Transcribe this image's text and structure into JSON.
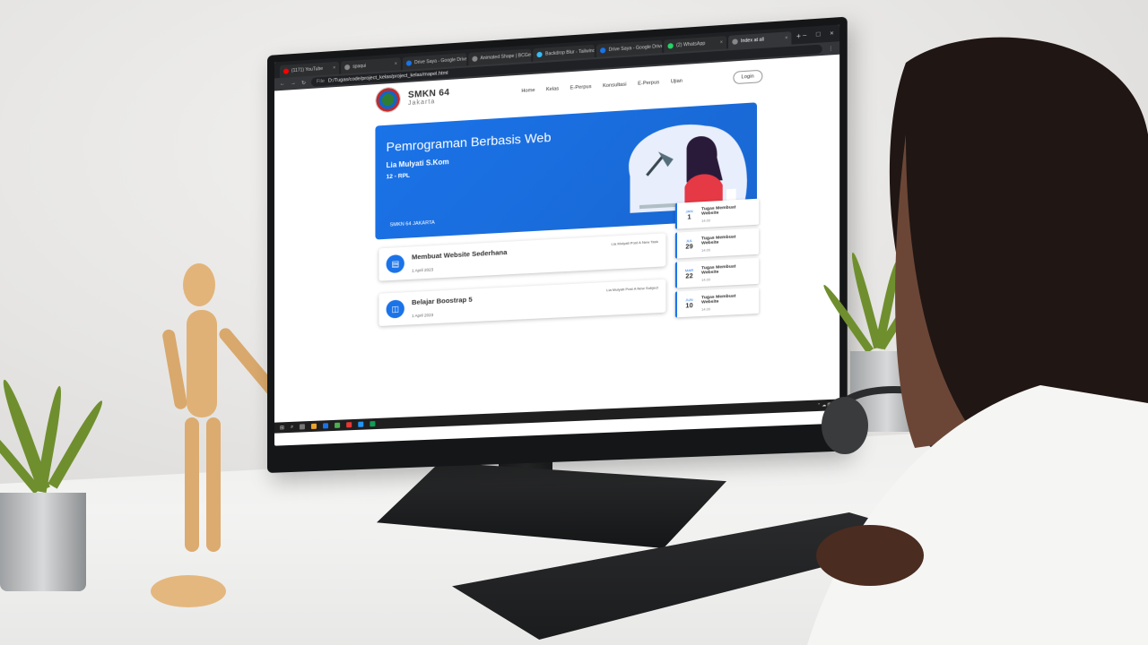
{
  "browser": {
    "tabs": [
      {
        "label": "(1171) YouTube",
        "color": "#ff0000"
      },
      {
        "label": "spaqui",
        "color": "#888888"
      },
      {
        "label": "Drive Saya - Google Drive",
        "color": "#1a73e8"
      },
      {
        "label": "Animated Shape | BCGer",
        "color": "#888888"
      },
      {
        "label": "Backdrop Blur - Tailwind",
        "color": "#38bdf8"
      },
      {
        "label": "Drive Saya - Google Drive",
        "color": "#1a73e8"
      },
      {
        "label": "(2) WhatsApp",
        "color": "#25d366"
      },
      {
        "label": "Index at all",
        "color": "#888888"
      }
    ],
    "address": {
      "scheme": "File",
      "url": "D:/Tugas/code/project_kelas/project_kelas/mapel.html"
    }
  },
  "site": {
    "brand": {
      "title": "SMKN 64",
      "subtitle": "Jakarta"
    },
    "menu": [
      "Home",
      "Kelas",
      "E-Perpus",
      "Konsultasi",
      "E-Perpus",
      "Ujian"
    ],
    "login_label": "Login",
    "banner": {
      "title": "Pemrograman Berbasis Web",
      "teacher": "Lia Mulyati S.Kom",
      "class": "12 - RPL",
      "school": "SMKN 64 JAKARTA"
    },
    "posts": [
      {
        "title": "Membuat Website Sederhana",
        "date": "1 April 2023",
        "by": "Lia Mulyati Post A New Task",
        "icon": "assignment-icon"
      },
      {
        "title": "Belajar Boostrap 5",
        "date": "1 April 2023",
        "by": "Lia Mulyati Post A New Subject",
        "icon": "book-icon"
      }
    ],
    "tasks": [
      {
        "month": "JAN",
        "day": "1",
        "title": "Tugas Membuat Website",
        "sub": "14.00"
      },
      {
        "month": "JUL",
        "day": "29",
        "title": "Tugas Membuat Website",
        "sub": "14.00"
      },
      {
        "month": "MAR",
        "day": "22",
        "title": "Tugas Membuat Website",
        "sub": "14.00"
      },
      {
        "month": "JUN",
        "day": "10",
        "title": "Tugas Membuat Website",
        "sub": "14.00"
      }
    ]
  },
  "accent_color": "#1a73e8"
}
